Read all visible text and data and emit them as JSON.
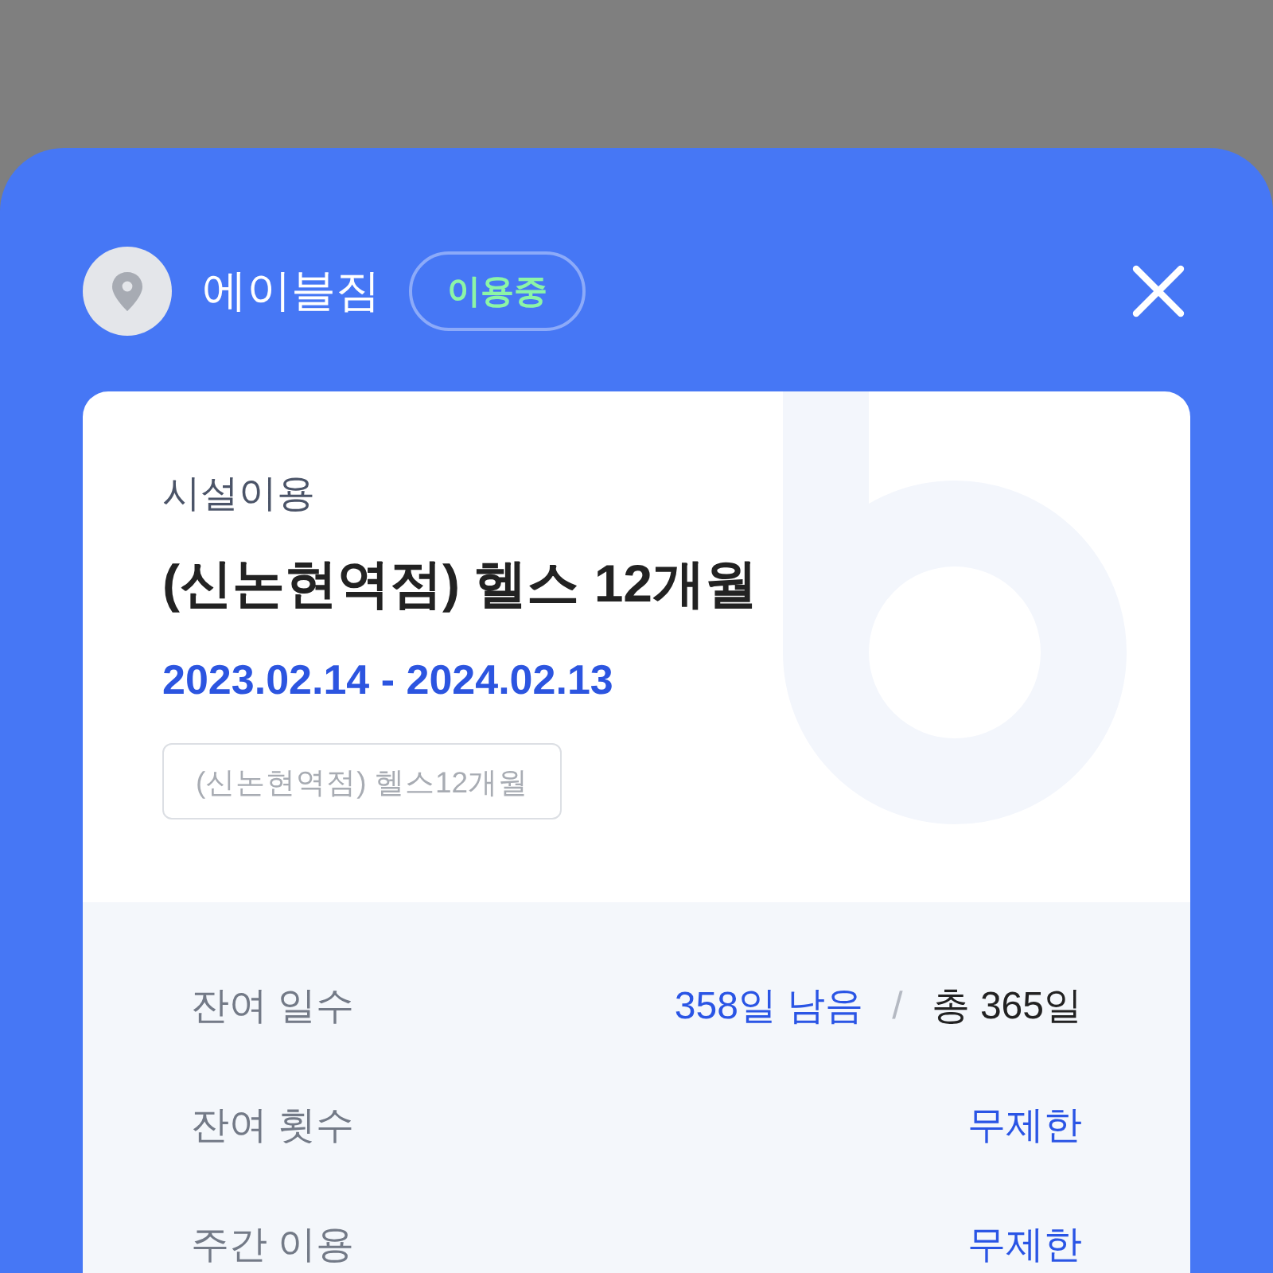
{
  "header": {
    "gym_name": "에이블짐",
    "status": "이용중"
  },
  "pass": {
    "category": "시설이용",
    "title": "(신논현역점) 헬스 12개월",
    "period": "2023.02.14 - 2024.02.13",
    "tag": "(신논현역점) 헬스12개월"
  },
  "details": [
    {
      "kind": "split",
      "label": "잔여 일수",
      "value": "358일 남음",
      "separator": "/",
      "total": "총 365일"
    },
    {
      "kind": "plain",
      "label": "잔여 횟수",
      "value": "무제한"
    },
    {
      "kind": "plain",
      "label": "주간 이용",
      "value": "무제한"
    }
  ]
}
